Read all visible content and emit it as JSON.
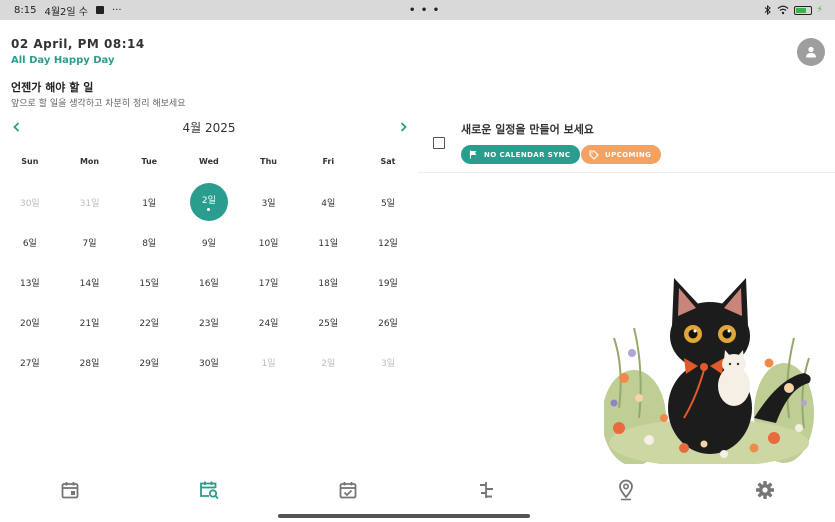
{
  "status_bar": {
    "time": "8:15",
    "date": "4월2일 수",
    "more": "···",
    "center_dots": "• • •",
    "icons": [
      "stop-icon",
      "bluetooth-icon",
      "wifi-icon",
      "battery-icon"
    ]
  },
  "header": {
    "date_title": "02 April, PM 08:14",
    "greeting": "All Day Happy Day"
  },
  "section": {
    "title": "언젠가 해야 할 일",
    "description": "앞으로 할 일을 생각하고 차분히 정리 해보세요"
  },
  "calendar": {
    "month_label": "4월 2025",
    "weekdays": [
      "Sun",
      "Mon",
      "Tue",
      "Wed",
      "Thu",
      "Fri",
      "Sat"
    ],
    "weeks": [
      [
        {
          "label": "30일",
          "muted": true
        },
        {
          "label": "31일",
          "muted": true
        },
        {
          "label": "1일"
        },
        {
          "label": "2일",
          "selected": true
        },
        {
          "label": "3일"
        },
        {
          "label": "4일"
        },
        {
          "label": "5일"
        }
      ],
      [
        {
          "label": "6일"
        },
        {
          "label": "7일"
        },
        {
          "label": "8일"
        },
        {
          "label": "9일"
        },
        {
          "label": "10일"
        },
        {
          "label": "11일"
        },
        {
          "label": "12일"
        }
      ],
      [
        {
          "label": "13일"
        },
        {
          "label": "14일"
        },
        {
          "label": "15일"
        },
        {
          "label": "16일"
        },
        {
          "label": "17일"
        },
        {
          "label": "18일"
        },
        {
          "label": "19일"
        }
      ],
      [
        {
          "label": "20일"
        },
        {
          "label": "21일"
        },
        {
          "label": "22일"
        },
        {
          "label": "23일"
        },
        {
          "label": "24일"
        },
        {
          "label": "25일"
        },
        {
          "label": "26일"
        }
      ],
      [
        {
          "label": "27일"
        },
        {
          "label": "28일"
        },
        {
          "label": "29일"
        },
        {
          "label": "30일"
        },
        {
          "label": "1일",
          "muted": true
        },
        {
          "label": "2일",
          "muted": true
        },
        {
          "label": "3일",
          "muted": true
        }
      ]
    ]
  },
  "event": {
    "title": "새로운 일정을 만들어 보세요",
    "chips": [
      {
        "label": "NO CALENDAR SYNC",
        "icon": "flag-icon",
        "color": "#2a9d8f"
      },
      {
        "label": "UPCOMING",
        "icon": "tag-icon",
        "color": "#f4a261"
      }
    ]
  },
  "nav": {
    "items": [
      {
        "name": "calendar",
        "icon": "calendar-icon",
        "active": false
      },
      {
        "name": "search-calendar",
        "icon": "calendar-search-icon",
        "active": true
      },
      {
        "name": "tasks",
        "icon": "calendar-check-icon",
        "active": false
      },
      {
        "name": "timeline",
        "icon": "timeline-icon",
        "active": false
      },
      {
        "name": "location",
        "icon": "location-pin-icon",
        "active": false
      },
      {
        "name": "settings",
        "icon": "gear-icon",
        "active": false
      }
    ]
  },
  "colors": {
    "accent": "#2a9d8f",
    "warning": "#f4a261",
    "icon_gray": "#757575"
  }
}
